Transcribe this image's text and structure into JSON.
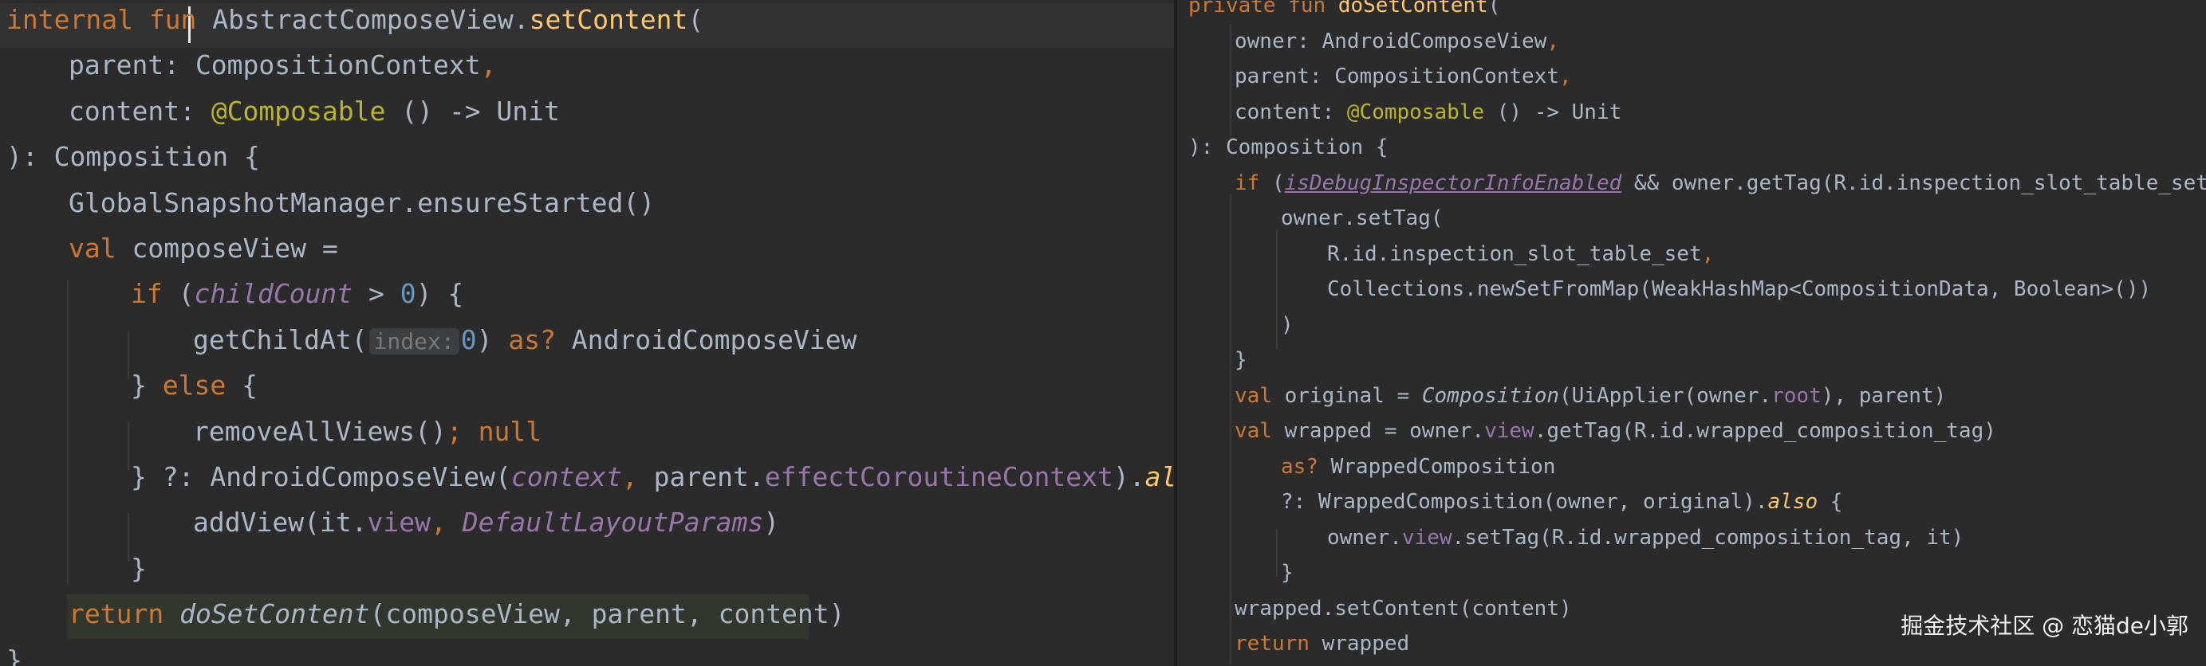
{
  "left_pane": {
    "lines": [
      {
        "indent": 0,
        "tokens": [
          {
            "t": "internal ",
            "c": "c-kw"
          },
          {
            "t": "fun",
            "c": "c-kw"
          },
          {
            "t": " AbstractComposeView.",
            "c": "c-default"
          },
          {
            "t": "setContent",
            "c": "c-fn"
          },
          {
            "t": "(",
            "c": "c-default"
          }
        ]
      },
      {
        "indent": 1,
        "tokens": [
          {
            "t": "parent: CompositionContext",
            "c": "c-default"
          },
          {
            "t": ",",
            "c": "c-kw"
          }
        ]
      },
      {
        "indent": 1,
        "tokens": [
          {
            "t": "content: ",
            "c": "c-default"
          },
          {
            "t": "@Composable",
            "c": "c-ann"
          },
          {
            "t": " () -> Unit",
            "c": "c-default"
          }
        ]
      },
      {
        "indent": 0,
        "tokens": [
          {
            "t": "): Composition {",
            "c": "c-default"
          }
        ]
      },
      {
        "indent": 1,
        "tokens": [
          {
            "t": "GlobalSnapshotManager.ensureStarted()",
            "c": "c-default"
          }
        ]
      },
      {
        "indent": 1,
        "tokens": [
          {
            "t": "val ",
            "c": "c-kw"
          },
          {
            "t": "composeView = ",
            "c": "c-default"
          }
        ]
      },
      {
        "indent": 2,
        "tokens": [
          {
            "t": "if ",
            "c": "c-kw"
          },
          {
            "t": "(",
            "c": "c-default"
          },
          {
            "t": "childCount",
            "c": "c-italic-prop"
          },
          {
            "t": " > ",
            "c": "c-default"
          },
          {
            "t": "0",
            "c": "c-num"
          },
          {
            "t": ") {",
            "c": "c-default"
          }
        ]
      },
      {
        "indent": 3,
        "tokens": [
          {
            "t": "getChildAt(",
            "c": "c-default"
          },
          {
            "t": "index:",
            "c": "hint"
          },
          {
            "t": "0",
            "c": "c-num"
          },
          {
            "t": ") ",
            "c": "c-default"
          },
          {
            "t": "as?",
            "c": "c-kw"
          },
          {
            "t": " AndroidComposeView",
            "c": "c-default"
          }
        ]
      },
      {
        "indent": 2,
        "tokens": [
          {
            "t": "} ",
            "c": "c-default"
          },
          {
            "t": "else",
            "c": "c-kw"
          },
          {
            "t": " {",
            "c": "c-default"
          }
        ]
      },
      {
        "indent": 3,
        "tokens": [
          {
            "t": "removeAllViews()",
            "c": "c-default"
          },
          {
            "t": "; ",
            "c": "c-kw"
          },
          {
            "t": "null",
            "c": "c-kw"
          }
        ]
      },
      {
        "indent": 2,
        "tokens": [
          {
            "t": "} ?: AndroidComposeView(",
            "c": "c-default"
          },
          {
            "t": "context",
            "c": "c-italic-prop"
          },
          {
            "t": ", ",
            "c": "c-kw"
          },
          {
            "t": "parent.",
            "c": "c-default"
          },
          {
            "t": "effectCoroutineContext",
            "c": "c-prop"
          },
          {
            "t": ").",
            "c": "c-default"
          },
          {
            "t": "also",
            "c": "c-ext"
          },
          {
            "t": " {",
            "c": "c-default"
          }
        ]
      },
      {
        "indent": 3,
        "tokens": [
          {
            "t": "addView(it.",
            "c": "c-default"
          },
          {
            "t": "view",
            "c": "c-prop"
          },
          {
            "t": ", ",
            "c": "c-kw"
          },
          {
            "t": "DefaultLayoutParams",
            "c": "c-italic-static"
          },
          {
            "t": ")",
            "c": "c-default"
          }
        ]
      },
      {
        "indent": 2,
        "tokens": [
          {
            "t": "}",
            "c": "c-default"
          }
        ]
      },
      {
        "indent": 1,
        "tokens": [
          {
            "t": "return ",
            "c": "c-kw"
          },
          {
            "t": "doSetContent",
            "c": "c-italic-fn"
          },
          {
            "t": "(composeView, parent, content)",
            "c": "c-default"
          }
        ]
      },
      {
        "indent": 0,
        "tokens": [
          {
            "t": "}",
            "c": "c-default"
          }
        ]
      }
    ]
  },
  "right_pane": {
    "lines": [
      {
        "indent": 0,
        "tokens": [
          {
            "t": "private fun ",
            "c": "c-kw"
          },
          {
            "t": "doSetContent",
            "c": "c-fn"
          },
          {
            "t": "(",
            "c": "c-default"
          }
        ]
      },
      {
        "indent": 1,
        "tokens": [
          {
            "t": "owner: AndroidComposeView",
            "c": "c-default"
          },
          {
            "t": ",",
            "c": "c-kw"
          }
        ]
      },
      {
        "indent": 1,
        "tokens": [
          {
            "t": "parent: CompositionContext",
            "c": "c-default"
          },
          {
            "t": ",",
            "c": "c-kw"
          }
        ]
      },
      {
        "indent": 1,
        "tokens": [
          {
            "t": "content: ",
            "c": "c-default"
          },
          {
            "t": "@Composable",
            "c": "c-ann"
          },
          {
            "t": " () -> Unit",
            "c": "c-default"
          }
        ]
      },
      {
        "indent": 0,
        "tokens": [
          {
            "t": "): Composition {",
            "c": "c-default"
          }
        ]
      },
      {
        "indent": 1,
        "tokens": [
          {
            "t": "if ",
            "c": "c-kw"
          },
          {
            "t": "(",
            "c": "c-default"
          },
          {
            "t": "isDebugInspectorInfoEnabled",
            "c": "c-debug"
          },
          {
            "t": " && owner.getTag(R.id.inspection_slot_table_set) ==",
            "c": "c-default"
          }
        ]
      },
      {
        "indent": 2,
        "tokens": [
          {
            "t": "owner.setTag(",
            "c": "c-default"
          }
        ]
      },
      {
        "indent": 3,
        "tokens": [
          {
            "t": "R.id.inspection_slot_table_set",
            "c": "c-default"
          },
          {
            "t": ",",
            "c": "c-kw"
          }
        ]
      },
      {
        "indent": 3,
        "tokens": [
          {
            "t": "Collections.newSetFromMap(WeakHashMap<CompositionData, Boolean>())",
            "c": "c-default"
          }
        ]
      },
      {
        "indent": 2,
        "tokens": [
          {
            "t": ")",
            "c": "c-default"
          }
        ]
      },
      {
        "indent": 1,
        "tokens": [
          {
            "t": "}",
            "c": "c-default"
          }
        ]
      },
      {
        "indent": 1,
        "tokens": [
          {
            "t": "val ",
            "c": "c-kw"
          },
          {
            "t": "original = ",
            "c": "c-default"
          },
          {
            "t": "Composition",
            "c": "c-italic-fn"
          },
          {
            "t": "(UiApplier(owner.",
            "c": "c-default"
          },
          {
            "t": "root",
            "c": "c-prop"
          },
          {
            "t": "), parent)",
            "c": "c-default"
          }
        ]
      },
      {
        "indent": 1,
        "tokens": [
          {
            "t": "val ",
            "c": "c-kw"
          },
          {
            "t": "wrapped = owner.",
            "c": "c-default"
          },
          {
            "t": "view",
            "c": "c-prop"
          },
          {
            "t": ".getTag(R.id.wrapped_composition_tag)",
            "c": "c-default"
          }
        ]
      },
      {
        "indent": 2,
        "tokens": [
          {
            "t": "as?",
            "c": "c-kw"
          },
          {
            "t": " WrappedComposition",
            "c": "c-default"
          }
        ]
      },
      {
        "indent": 2,
        "tokens": [
          {
            "t": "?: WrappedComposition(owner, original).",
            "c": "c-default"
          },
          {
            "t": "also",
            "c": "c-ext"
          },
          {
            "t": " {",
            "c": "c-default"
          }
        ]
      },
      {
        "indent": 3,
        "tokens": [
          {
            "t": "owner.",
            "c": "c-default"
          },
          {
            "t": "view",
            "c": "c-prop"
          },
          {
            "t": ".setTag(R.id.wrapped_composition_tag, it)",
            "c": "c-default"
          }
        ]
      },
      {
        "indent": 2,
        "tokens": [
          {
            "t": "}",
            "c": "c-default"
          }
        ]
      },
      {
        "indent": 1,
        "tokens": [
          {
            "t": "wrapped.setContent(content)",
            "c": "c-default"
          }
        ]
      },
      {
        "indent": 1,
        "tokens": [
          {
            "t": "return ",
            "c": "c-kw"
          },
          {
            "t": "wrapped",
            "c": "c-default"
          }
        ]
      }
    ]
  },
  "watermark": "掘金技术社区 @ 恋猫de小郭"
}
